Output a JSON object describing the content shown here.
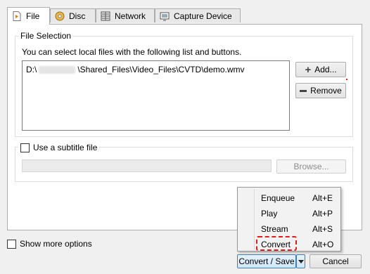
{
  "tabs": [
    {
      "label": "File",
      "icon": "file-play-icon"
    },
    {
      "label": "Disc",
      "icon": "disc-icon"
    },
    {
      "label": "Network",
      "icon": "network-icon"
    },
    {
      "label": "Capture Device",
      "icon": "capture-device-icon"
    }
  ],
  "file_selection": {
    "title": "File Selection",
    "instructions": "You can select local files with the following list and buttons.",
    "entry_prefix": "D:\\",
    "entry_suffix": "\\Shared_Files\\Video_Files\\CVTD\\demo.wmv",
    "add_label": "Add...",
    "remove_label": "Remove"
  },
  "subtitle": {
    "checkbox_label": "Use a subtitle file",
    "browse_label": "Browse..."
  },
  "show_more_label": "Show more options",
  "menu": {
    "items": [
      {
        "label": "Enqueue",
        "shortcut": "Alt+E"
      },
      {
        "label": "Play",
        "shortcut": "Alt+P"
      },
      {
        "label": "Stream",
        "shortcut": "Alt+S"
      },
      {
        "label": "Convert",
        "shortcut": "Alt+O"
      }
    ],
    "highlight_color": "#e21b1b"
  },
  "footer": {
    "convert_save_label": "Convert / Save",
    "cancel_label": "Cancel"
  }
}
